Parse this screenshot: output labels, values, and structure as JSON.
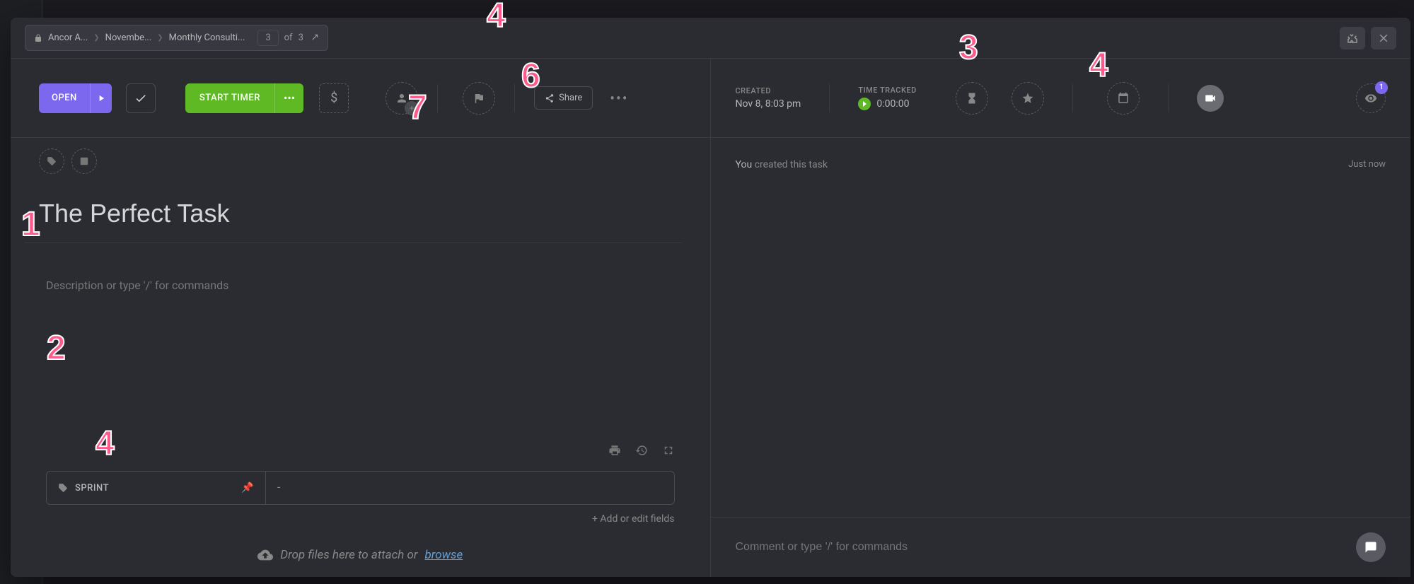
{
  "breadcrumb": {
    "items": [
      "Ancor A...",
      "Novembe...",
      "Monthly Consulti..."
    ]
  },
  "pagination": {
    "current": "3",
    "of_text": "of",
    "total": "3"
  },
  "toolbar": {
    "status": "OPEN",
    "timer": "START TIMER",
    "currency": "$",
    "share": "Share"
  },
  "task": {
    "title": "The Perfect Task",
    "description_placeholder": "Description or type '/' for commands"
  },
  "sprint": {
    "label": "SPRINT",
    "value": "-"
  },
  "fields": {
    "add": "+ Add or edit fields"
  },
  "attach": {
    "text": "Drop files here to attach or ",
    "link": "browse"
  },
  "info": {
    "created_label": "CREATED",
    "created_value": "Nov 8, 8:03 pm",
    "tracked_label": "TIME TRACKED",
    "tracked_value": "0:00:00"
  },
  "watch": {
    "count": "1"
  },
  "activity": {
    "you": "You",
    "text": " created this task",
    "time": "Just now"
  },
  "comment": {
    "placeholder": "Comment or type '/' for commands"
  },
  "annotations": {
    "a1": "1",
    "a2": "2",
    "a3": "3",
    "a4_top": "4",
    "a4_left": "4",
    "a4_right": "4",
    "a6": "6",
    "a7": "7"
  }
}
